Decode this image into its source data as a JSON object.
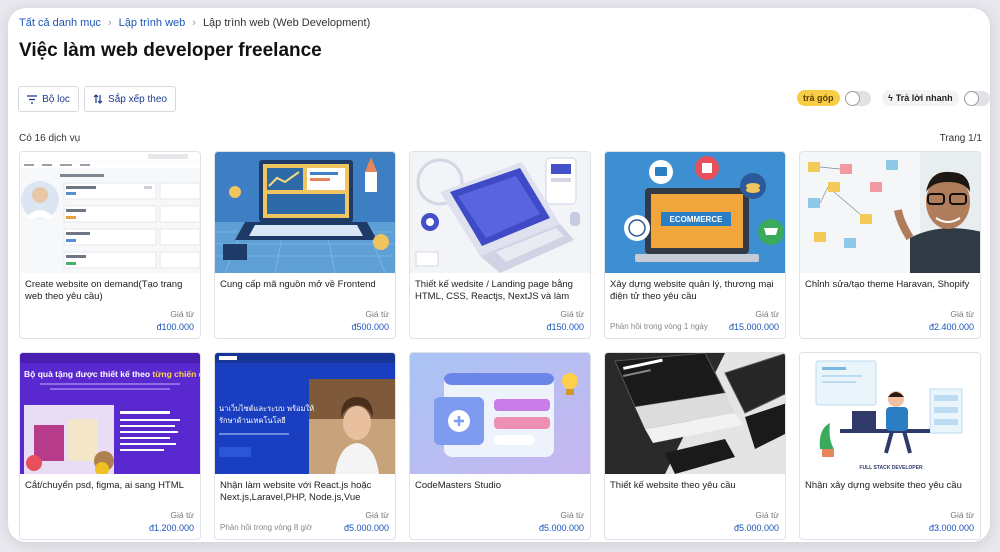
{
  "breadcrumb": {
    "all": "Tất cả danh mục",
    "web": "Lập trình web",
    "current": "Lập trình web (Web Development)"
  },
  "title": "Việc làm web developer freelance",
  "toolbar": {
    "filter": "Bộ lọc",
    "sort": "Sắp xếp theo",
    "installment": "trả góp",
    "quick_reply": "Trả lời nhanh"
  },
  "count_text": "Có 16 dịch vụ",
  "page_text": "Trang 1/1",
  "price_label": "Giá từ",
  "colors": {
    "link": "#1a56b8",
    "badge": "#f6cd45"
  },
  "cards": [
    {
      "title": "Create website on demand(Tạo trang web theo yêu cầu)",
      "price": "đ100.000",
      "response": "",
      "thumb": "dashboard-screenshot"
    },
    {
      "title": "Cung cấp mã nguồn mở về Frontend",
      "price": "đ500.000",
      "response": "",
      "thumb": "isometric-laptop-illustration"
    },
    {
      "title": "Thiết kế wedsite / Landing page bằng HTML, CSS, Reactjs, NextJS và làm theo",
      "price": "đ150.000",
      "response": "",
      "thumb": "laptop-ui-illustration"
    },
    {
      "title": "Xây dựng website quản lý, thương mại điện tử theo yêu cầu",
      "price": "đ15.000.000",
      "response": "Phản hồi trong vòng 1 ngày",
      "thumb": "ecommerce-illustration"
    },
    {
      "title": "Chỉnh sửa/tạo theme Haravan, Shopify",
      "price": "đ2.400.000",
      "response": "",
      "thumb": "man-whiteboard-photo"
    },
    {
      "title": "Cắt/chuyển psd, figma, ai sang HTML",
      "price": "đ1.200.000",
      "response": "",
      "thumb": "gift-promo-banner"
    },
    {
      "title": "Nhận làm website với React.js hoặc Next.js,Laravel,PHP, Node.js,Vue js,Mysql,",
      "price": "đ5.000.000",
      "response": "Phản hồi trong vòng 8 giờ",
      "thumb": "thai-landing-page"
    },
    {
      "title": "CodeMasters Studio",
      "price": "đ5.000.000",
      "response": "",
      "thumb": "3d-ui-illustration"
    },
    {
      "title": "Thiết kế website theo yêu cầu",
      "price": "đ5.000.000",
      "response": "",
      "thumb": "dark-desk-mockup"
    },
    {
      "title": "Nhận xây dựng website theo yêu cầu",
      "price": "đ3.000.000",
      "response": "",
      "thumb": "full-stack-developer-illustration"
    }
  ],
  "thumb_text": {
    "banner_title": "Bộ quà tặng được thiết kế theo",
    "banner_highlight": "từng chiến dịch",
    "thai_line1": "นาเว็บไซต์และระบบ พร้อมให้",
    "thai_line2": "รักษาด้านเทคโนโลยี",
    "full_stack": "FULL STACK DEVELOPER",
    "ecommerce": "ECOMMERCE"
  }
}
